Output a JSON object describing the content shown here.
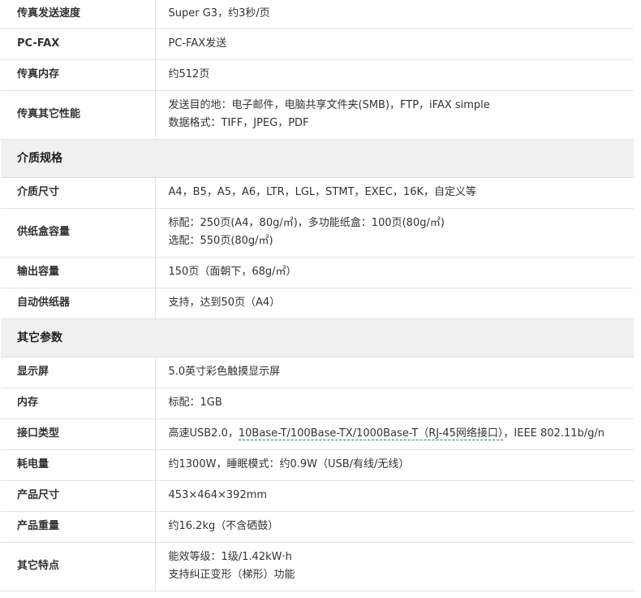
{
  "rows": [
    {
      "type": "row",
      "height": 35,
      "key": "传真发送速度",
      "lines": [
        [
          "Super G3，约3秒/页"
        ]
      ]
    },
    {
      "type": "row",
      "height": 38,
      "key": "PC-FAX",
      "lines": [
        [
          "PC-FAX发送"
        ]
      ]
    },
    {
      "type": "row",
      "height": 38,
      "key": "传真内存",
      "lines": [
        [
          "约512页"
        ]
      ]
    },
    {
      "type": "row",
      "height": 60,
      "key": "传真其它性能",
      "lines": [
        [
          "发送目的地：电子邮件，电脑共享文件夹(SMB)，FTP，iFAX simple"
        ],
        [
          "数据格式：TIFF，JPEG，PDF"
        ]
      ]
    },
    {
      "type": "section",
      "height": 47,
      "key": "介质规格"
    },
    {
      "type": "row",
      "height": 38,
      "key": "介质尺寸",
      "lines": [
        [
          "A4，B5，A5，A6，LTR，LGL，STMT，EXEC，16K，自定义等"
        ]
      ]
    },
    {
      "type": "row",
      "height": 60,
      "key": "供纸盒容量",
      "lines": [
        [
          "标配：250页(A4，80g/㎡)，多功能纸盒：100页(80g/㎡)"
        ],
        [
          "选配：550页(80g/㎡)"
        ]
      ]
    },
    {
      "type": "row",
      "height": 38,
      "key": "输出容量",
      "lines": [
        [
          "150页（面朝下，68g/㎡）"
        ]
      ]
    },
    {
      "type": "row",
      "height": 38,
      "key": "自动供纸器",
      "lines": [
        [
          "支持，达到50页（A4）"
        ]
      ]
    },
    {
      "type": "section",
      "height": 47,
      "key": "其它参数"
    },
    {
      "type": "row",
      "height": 38,
      "key": "显示屏",
      "lines": [
        [
          "5.0英寸彩色触摸显示屏"
        ]
      ]
    },
    {
      "type": "row",
      "height": 38,
      "key": "内存",
      "lines": [
        [
          "标配：1GB"
        ]
      ]
    },
    {
      "type": "row",
      "height": 38,
      "key": "接口类型",
      "lines": [
        [
          "高速USB2.0，",
          "10Base-T/100Base-TX/1000Base-T（RJ-45网络接口）",
          "，IEEE 802.11b/g/n"
        ]
      ]
    },
    {
      "type": "row",
      "height": 38,
      "key": "耗电量",
      "lines": [
        [
          "约1300W，睡眠模式：约0.9W（USB/有线/无线）"
        ]
      ]
    },
    {
      "type": "row",
      "height": 38,
      "key": "产品尺寸",
      "lines": [
        [
          "453×464×392mm"
        ]
      ]
    },
    {
      "type": "row",
      "height": 38,
      "key": "产品重量",
      "lines": [
        [
          "约16.2kg（不含硒鼓）"
        ]
      ]
    },
    {
      "type": "row",
      "height": 60,
      "key": "其它特点",
      "lines": [
        [
          "能效等级：1级/1.42kW·h"
        ],
        [
          "支持纠正变形（梯形）功能"
        ]
      ]
    }
  ]
}
